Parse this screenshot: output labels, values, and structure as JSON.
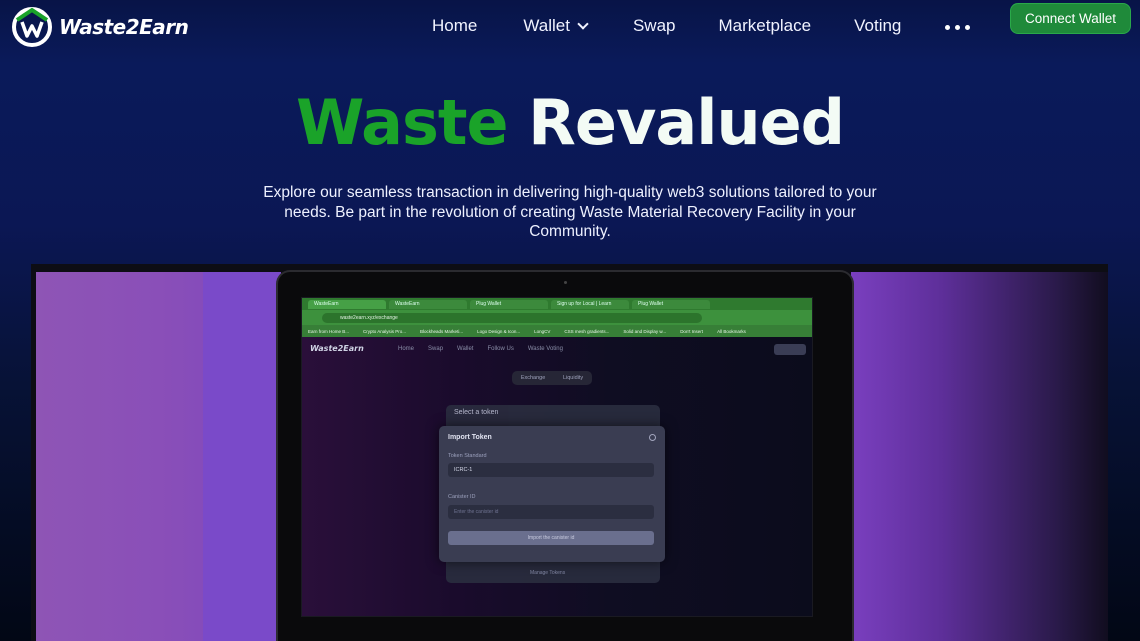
{
  "brand": {
    "name": "Waste2Earn"
  },
  "nav": {
    "items": [
      "Home",
      "Wallet",
      "Swap",
      "Marketplace",
      "Voting"
    ],
    "connect_label": "Connect Wallet"
  },
  "colors": {
    "accent_green": "#1aa329",
    "button_green": "#1f8a3a",
    "background_navy": "#0b1754"
  },
  "hero": {
    "title_part1": "Waste",
    "title_part2": "Revalued",
    "subtitle": "Explore our seamless transaction in delivering high-quality web3 solutions tailored to your needs. Be part in the revolution of creating Waste Material Recovery Facility in your Community."
  },
  "preview": {
    "tabs": [
      "WasteEarn",
      "WasteEarn",
      "Plug Wallet",
      "Sign up for Local | Learn",
      "Plug Wallet"
    ],
    "url": "waste2earn.xyz/exchange",
    "bookmarks": [
      "Earn from Home B...",
      "Crypto Analysis Pro...",
      "Blockheads Marketi...",
      "Logo Design & Icon...",
      "LongCV",
      "CSS mesh gradients...",
      "Solid and Display w...",
      "Don't Insert",
      "All Bookmarks"
    ],
    "app_logo": "Waste2Earn",
    "app_nav": [
      "Home",
      "Swap",
      "Wallet",
      "Follow Us",
      "Waste Voting"
    ],
    "toggle": [
      "Exchange",
      "Liquidity"
    ],
    "card_title": "Select a token",
    "modal": {
      "title": "Import Token",
      "label_standard": "Token Standard",
      "standard_value": "ICRC-1",
      "label_canister": "Canister ID",
      "canister_placeholder": "Enter the canister id",
      "button": "Import the canister id"
    },
    "footer_text": "Manage Tokens"
  }
}
